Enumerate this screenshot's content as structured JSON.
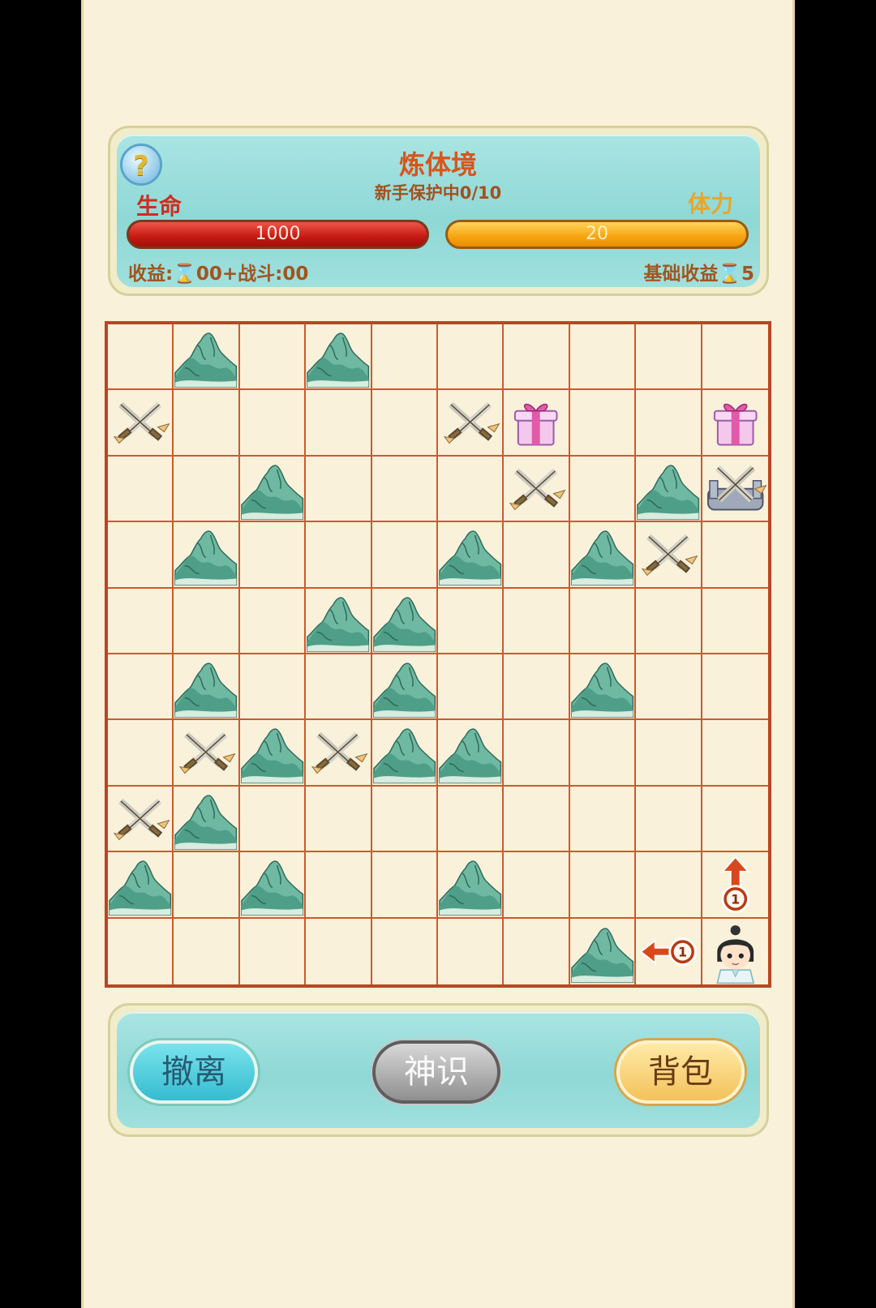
{
  "header": {
    "help_icon": "?",
    "realm_title": "炼体境",
    "protection_text": "新手保护中0/10",
    "life_label": "生命",
    "stamina_label": "体力",
    "life_value": "1000",
    "life_fraction": 1.0,
    "stamina_value": "20",
    "stamina_fraction": 1.0,
    "income_prefix": "收益:",
    "income_suffix": "00+战斗:00",
    "base_income_label": "基础收益",
    "base_income_value": "5"
  },
  "board": {
    "rows": 10,
    "cols": 10,
    "cells": [
      [
        "empty",
        "mountain",
        "empty",
        "mountain",
        "empty",
        "empty",
        "empty",
        "empty",
        "empty",
        "empty"
      ],
      [
        "battle",
        "empty",
        "empty",
        "empty",
        "empty",
        "battle",
        "gift",
        "empty",
        "empty",
        "gift"
      ],
      [
        "empty",
        "empty",
        "mountain",
        "empty",
        "empty",
        "empty",
        "battle",
        "empty",
        "mountain",
        "boss"
      ],
      [
        "empty",
        "mountain",
        "empty",
        "empty",
        "empty",
        "mountain",
        "empty",
        "mountain",
        "battle",
        "empty"
      ],
      [
        "empty",
        "empty",
        "empty",
        "mountain",
        "mountain",
        "empty",
        "empty",
        "empty",
        "empty",
        "empty"
      ],
      [
        "empty",
        "mountain",
        "empty",
        "empty",
        "mountain",
        "empty",
        "empty",
        "mountain",
        "empty",
        "empty"
      ],
      [
        "empty",
        "battle",
        "mountain",
        "battle",
        "mountain",
        "mountain",
        "empty",
        "empty",
        "empty",
        "empty"
      ],
      [
        "battle",
        "mountain",
        "empty",
        "empty",
        "empty",
        "empty",
        "empty",
        "empty",
        "empty",
        "empty"
      ],
      [
        "mountain",
        "empty",
        "mountain",
        "empty",
        "empty",
        "mountain",
        "empty",
        "empty",
        "empty",
        "arrow-up"
      ],
      [
        "empty",
        "empty",
        "empty",
        "empty",
        "empty",
        "empty",
        "empty",
        "mountain",
        "arrow-left",
        "player"
      ]
    ],
    "move_cost": "1"
  },
  "actions": {
    "retreat_label": "撤离",
    "sense_label": "神识",
    "bag_label": "背包"
  },
  "colors": {
    "background": "#faf1da",
    "grid_line": "#cc5a2e",
    "panel": "#9fe0dd",
    "life": "#c41a12",
    "stamina": "#f7a411"
  }
}
